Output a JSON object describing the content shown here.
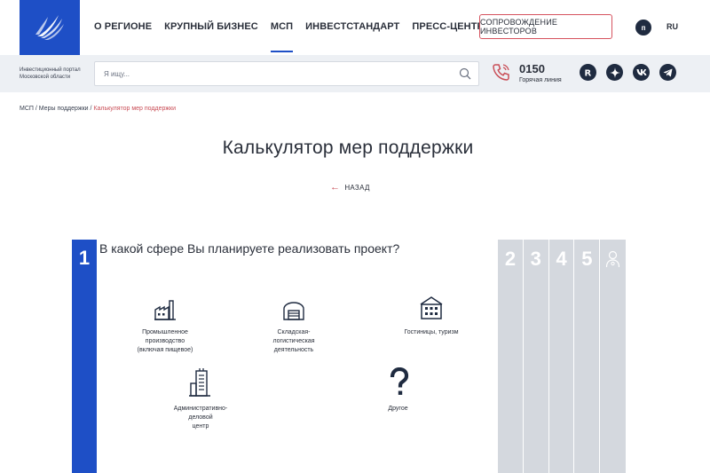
{
  "header": {
    "nav": [
      "О РЕГИОНЕ",
      "КРУПНЫЙ БИЗНЕС",
      "МСП",
      "ИНВЕСТСТАНДАРТ",
      "ПРЕСС-ЦЕНТР"
    ],
    "active_nav": "МСП",
    "invest_button": "СОПРОВОЖДЕНИЕ ИНВЕСТОРОВ",
    "accessibility": "п",
    "lang": "RU"
  },
  "subbar": {
    "portal_text": "Инвестиционный портал\nМосковской области",
    "search_placeholder": "Я ищу...",
    "hotline_number": "0150",
    "hotline_label": "Горячая линия"
  },
  "breadcrumbs": {
    "items": [
      "МСП",
      "Меры поддержки"
    ],
    "current": "Калькулятор мер поддержки"
  },
  "page": {
    "title": "Калькулятор мер поддержки",
    "back": "НАЗАД"
  },
  "calculator": {
    "active_step": "1",
    "question": "В какой сфере Вы планируете реализовать проект?",
    "steps": [
      "2",
      "3",
      "4",
      "5"
    ],
    "options": [
      {
        "label": "Промышленное\nпроизводство\n(включая пищевое)",
        "icon": "factory-icon"
      },
      {
        "label": "Складская-\nлогистическая\nдеятельность",
        "icon": "warehouse-icon"
      },
      {
        "label": "Гостиницы, туризм",
        "icon": "hotel-icon"
      },
      {
        "label": "Административно-\nделовой\nцентр",
        "icon": "office-building-icon"
      },
      {
        "label": "Другое",
        "icon": "question-icon"
      }
    ]
  },
  "colors": {
    "brand_blue": "#1e4fc6",
    "accent_red": "#c94d56",
    "dark": "#1f2b40",
    "step_gray": "#d4d8de"
  }
}
